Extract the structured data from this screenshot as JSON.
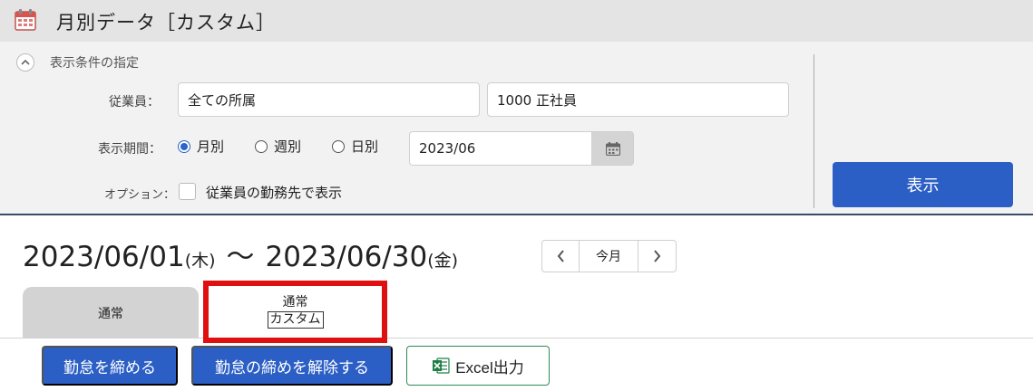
{
  "title": "月別データ［カスタム］",
  "filter": {
    "section_title": "表示条件の指定",
    "employee_label": "従業員：",
    "department_value": "全ての所属",
    "employment_value": "1000 正社員",
    "period_label": "表示期間：",
    "radio_month": "月別",
    "radio_week": "週別",
    "radio_day": "日別",
    "selected_period": "月別",
    "date_value": "2023/06",
    "option_label": "オプション：",
    "option_checkbox_label": "従業員の勤務先で表示",
    "option_checked": false,
    "show_button": "表示"
  },
  "range": {
    "start": "2023/06/01",
    "start_dow": "(木)",
    "separator": "〜",
    "end": "2023/06/30",
    "end_dow": "(金)"
  },
  "nav": {
    "today_label": "今月"
  },
  "tabs": {
    "tab1_label": "通常",
    "tab2_line1": "通常",
    "tab2_line2": "カスタム"
  },
  "actions": {
    "close_label": "勤怠を締める",
    "unclose_label": "勤怠の締めを解除する",
    "excel_label": "Excel出力"
  },
  "colors": {
    "primary_button": "#2c5fc5",
    "highlight_border": "#e11010",
    "excel_green": "#1e7e45"
  },
  "icons": {
    "title": "calendar-icon",
    "collapse": "chevron-up-icon",
    "date_picker": "calendar-icon",
    "prev": "chevron-left-icon",
    "next": "chevron-right-icon",
    "excel": "excel-icon"
  }
}
